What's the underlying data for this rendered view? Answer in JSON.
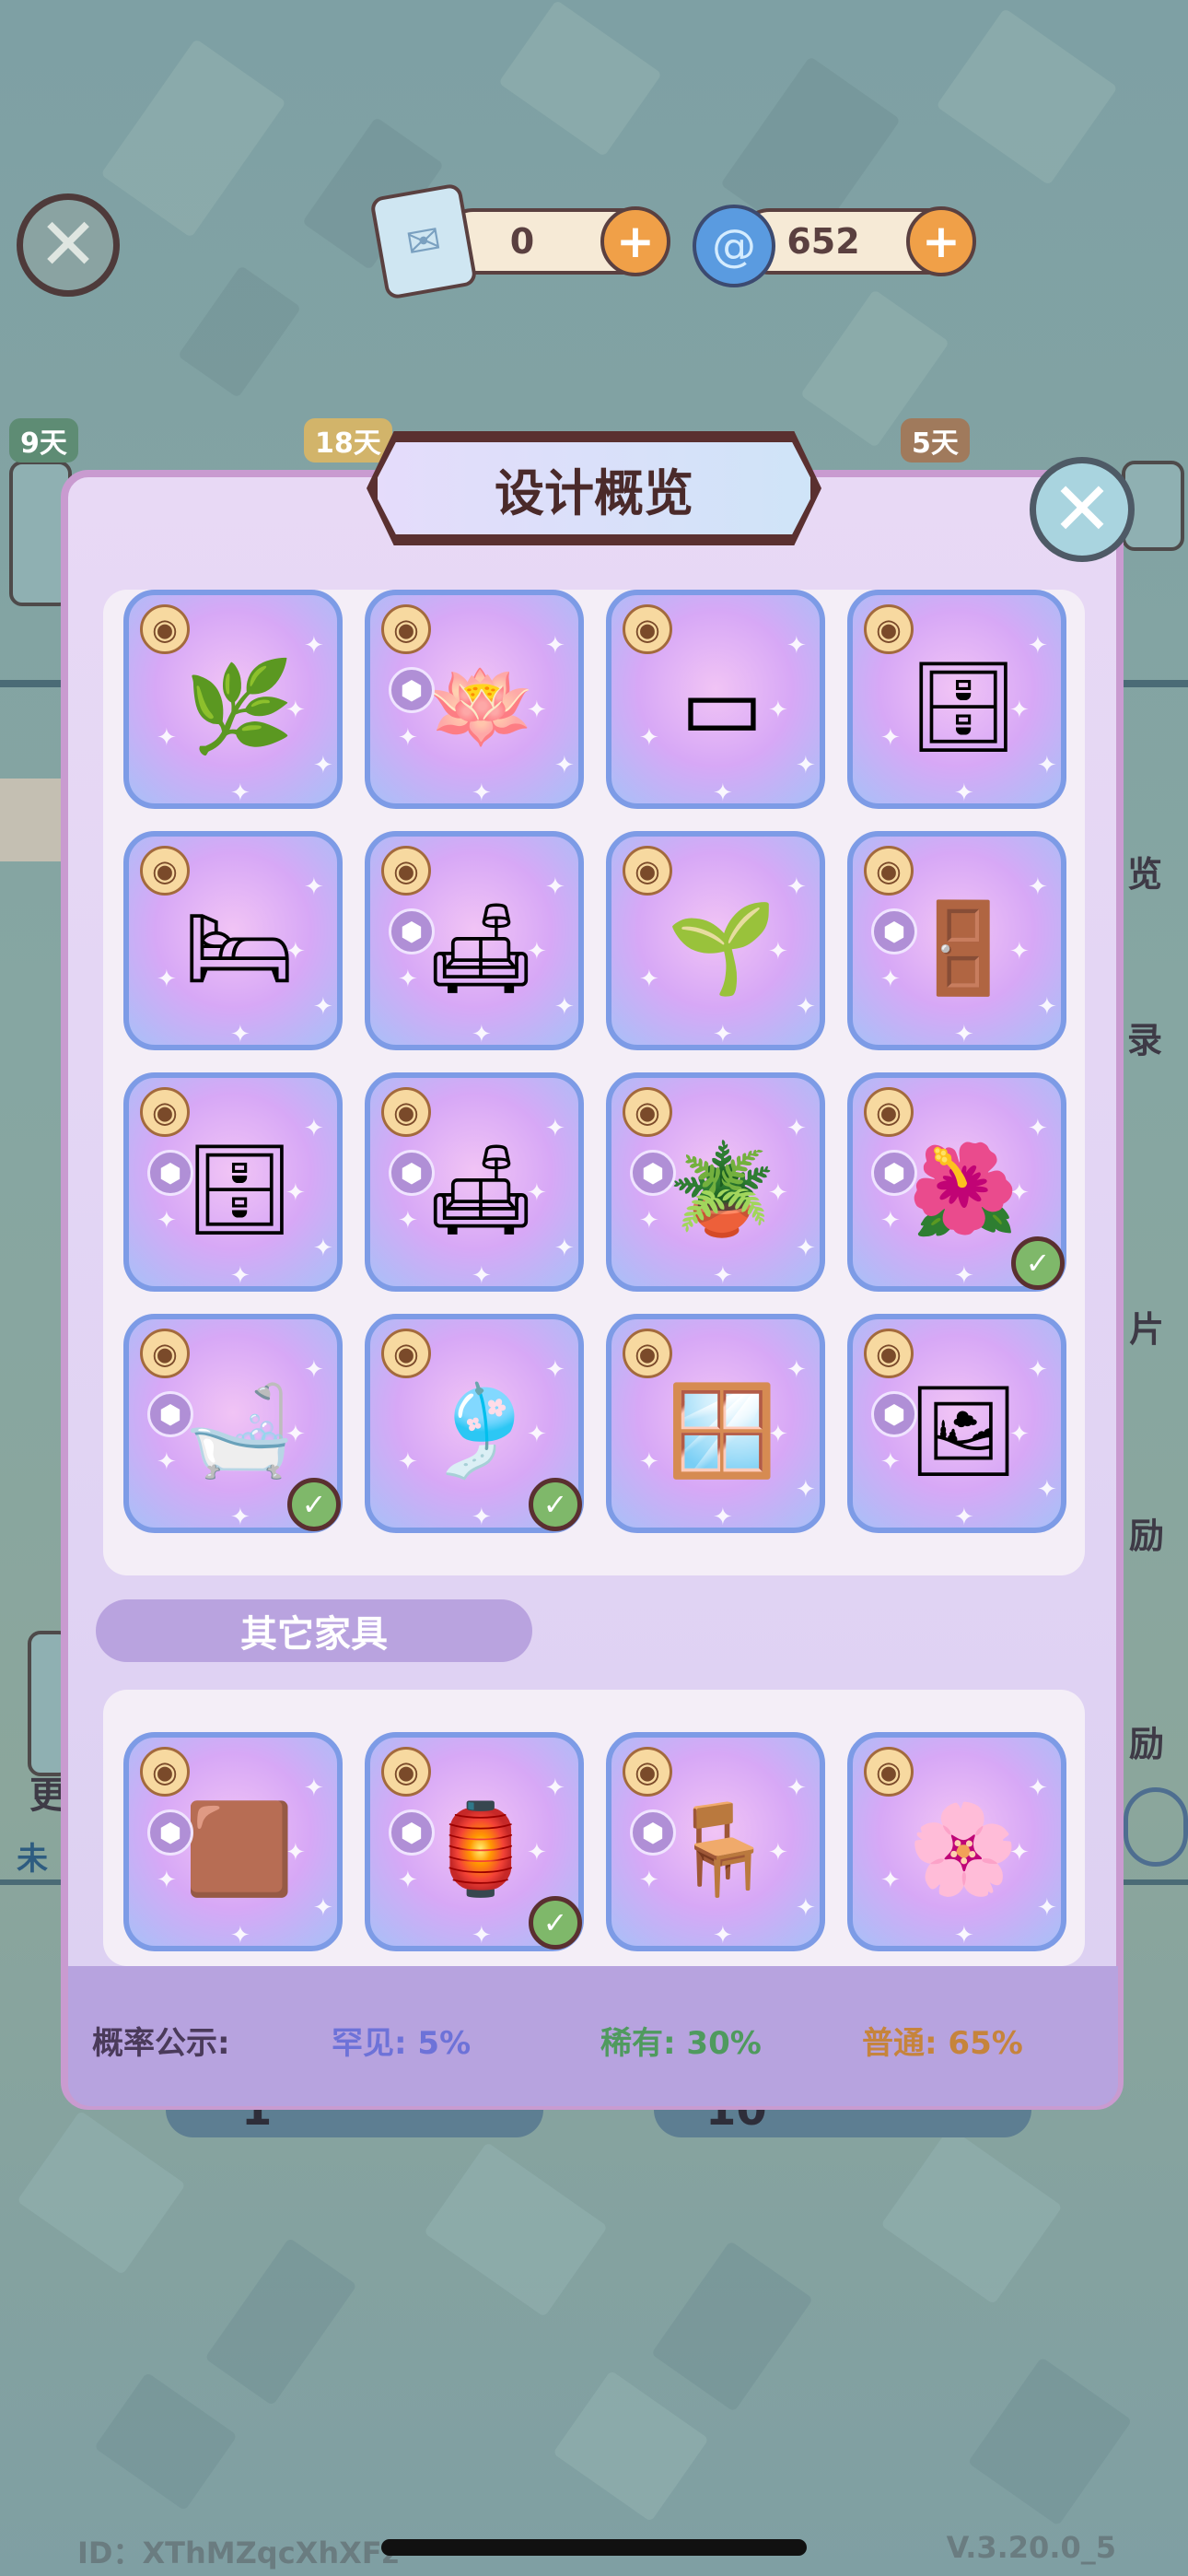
{
  "currency": {
    "tickets": "0",
    "gems": "652"
  },
  "tags": {
    "t1": "9天",
    "t2": "18天",
    "t3": "5天"
  },
  "modal": {
    "title": "设计概览"
  },
  "grid_items": [
    {
      "art": "🌿",
      "claimed": false,
      "cube": false
    },
    {
      "art": "🪷",
      "claimed": false,
      "cube": true
    },
    {
      "art": "▭",
      "claimed": false,
      "cube": false
    },
    {
      "art": "🗄",
      "claimed": false,
      "cube": false
    },
    {
      "art": "🛏",
      "claimed": false,
      "cube": false
    },
    {
      "art": "🛋",
      "claimed": false,
      "cube": true
    },
    {
      "art": "🌱",
      "claimed": false,
      "cube": false
    },
    {
      "art": "🚪",
      "claimed": false,
      "cube": true
    },
    {
      "art": "🗄",
      "claimed": false,
      "cube": true
    },
    {
      "art": "🛋",
      "claimed": false,
      "cube": true
    },
    {
      "art": "🪴",
      "claimed": false,
      "cube": true
    },
    {
      "art": "🌺",
      "claimed": true,
      "cube": true
    },
    {
      "art": "🛁",
      "claimed": true,
      "cube": true
    },
    {
      "art": "🎐",
      "claimed": true,
      "cube": false
    },
    {
      "art": "🪟",
      "claimed": false,
      "cube": false
    },
    {
      "art": "🖼",
      "claimed": false,
      "cube": true
    }
  ],
  "other_section": {
    "label": "其它家具"
  },
  "other_items": [
    {
      "art": "🟫",
      "claimed": false,
      "cube": true
    },
    {
      "art": "🏮",
      "claimed": true,
      "cube": true
    },
    {
      "art": "🪑",
      "claimed": false,
      "cube": true
    },
    {
      "art": "🌸",
      "claimed": false,
      "cube": false
    }
  ],
  "probability": {
    "label": "概率公示:",
    "rare": "罕见: 5%",
    "uncommon": "稀有: 30%",
    "common": "普通: 65%"
  },
  "colors": {
    "rare": "#6d72d8",
    "uncommon": "#4f9a5e",
    "common": "#c6843c"
  },
  "side": {
    "a": "览",
    "b": "录",
    "c": "片",
    "d": "励",
    "e": "励",
    "f": "更",
    "g": "未"
  },
  "behind": {
    "n1": "1",
    "n2": "10"
  },
  "footer": {
    "id": "ID：XThMZqcXhXFz",
    "version": "V.3.20.0_5"
  }
}
